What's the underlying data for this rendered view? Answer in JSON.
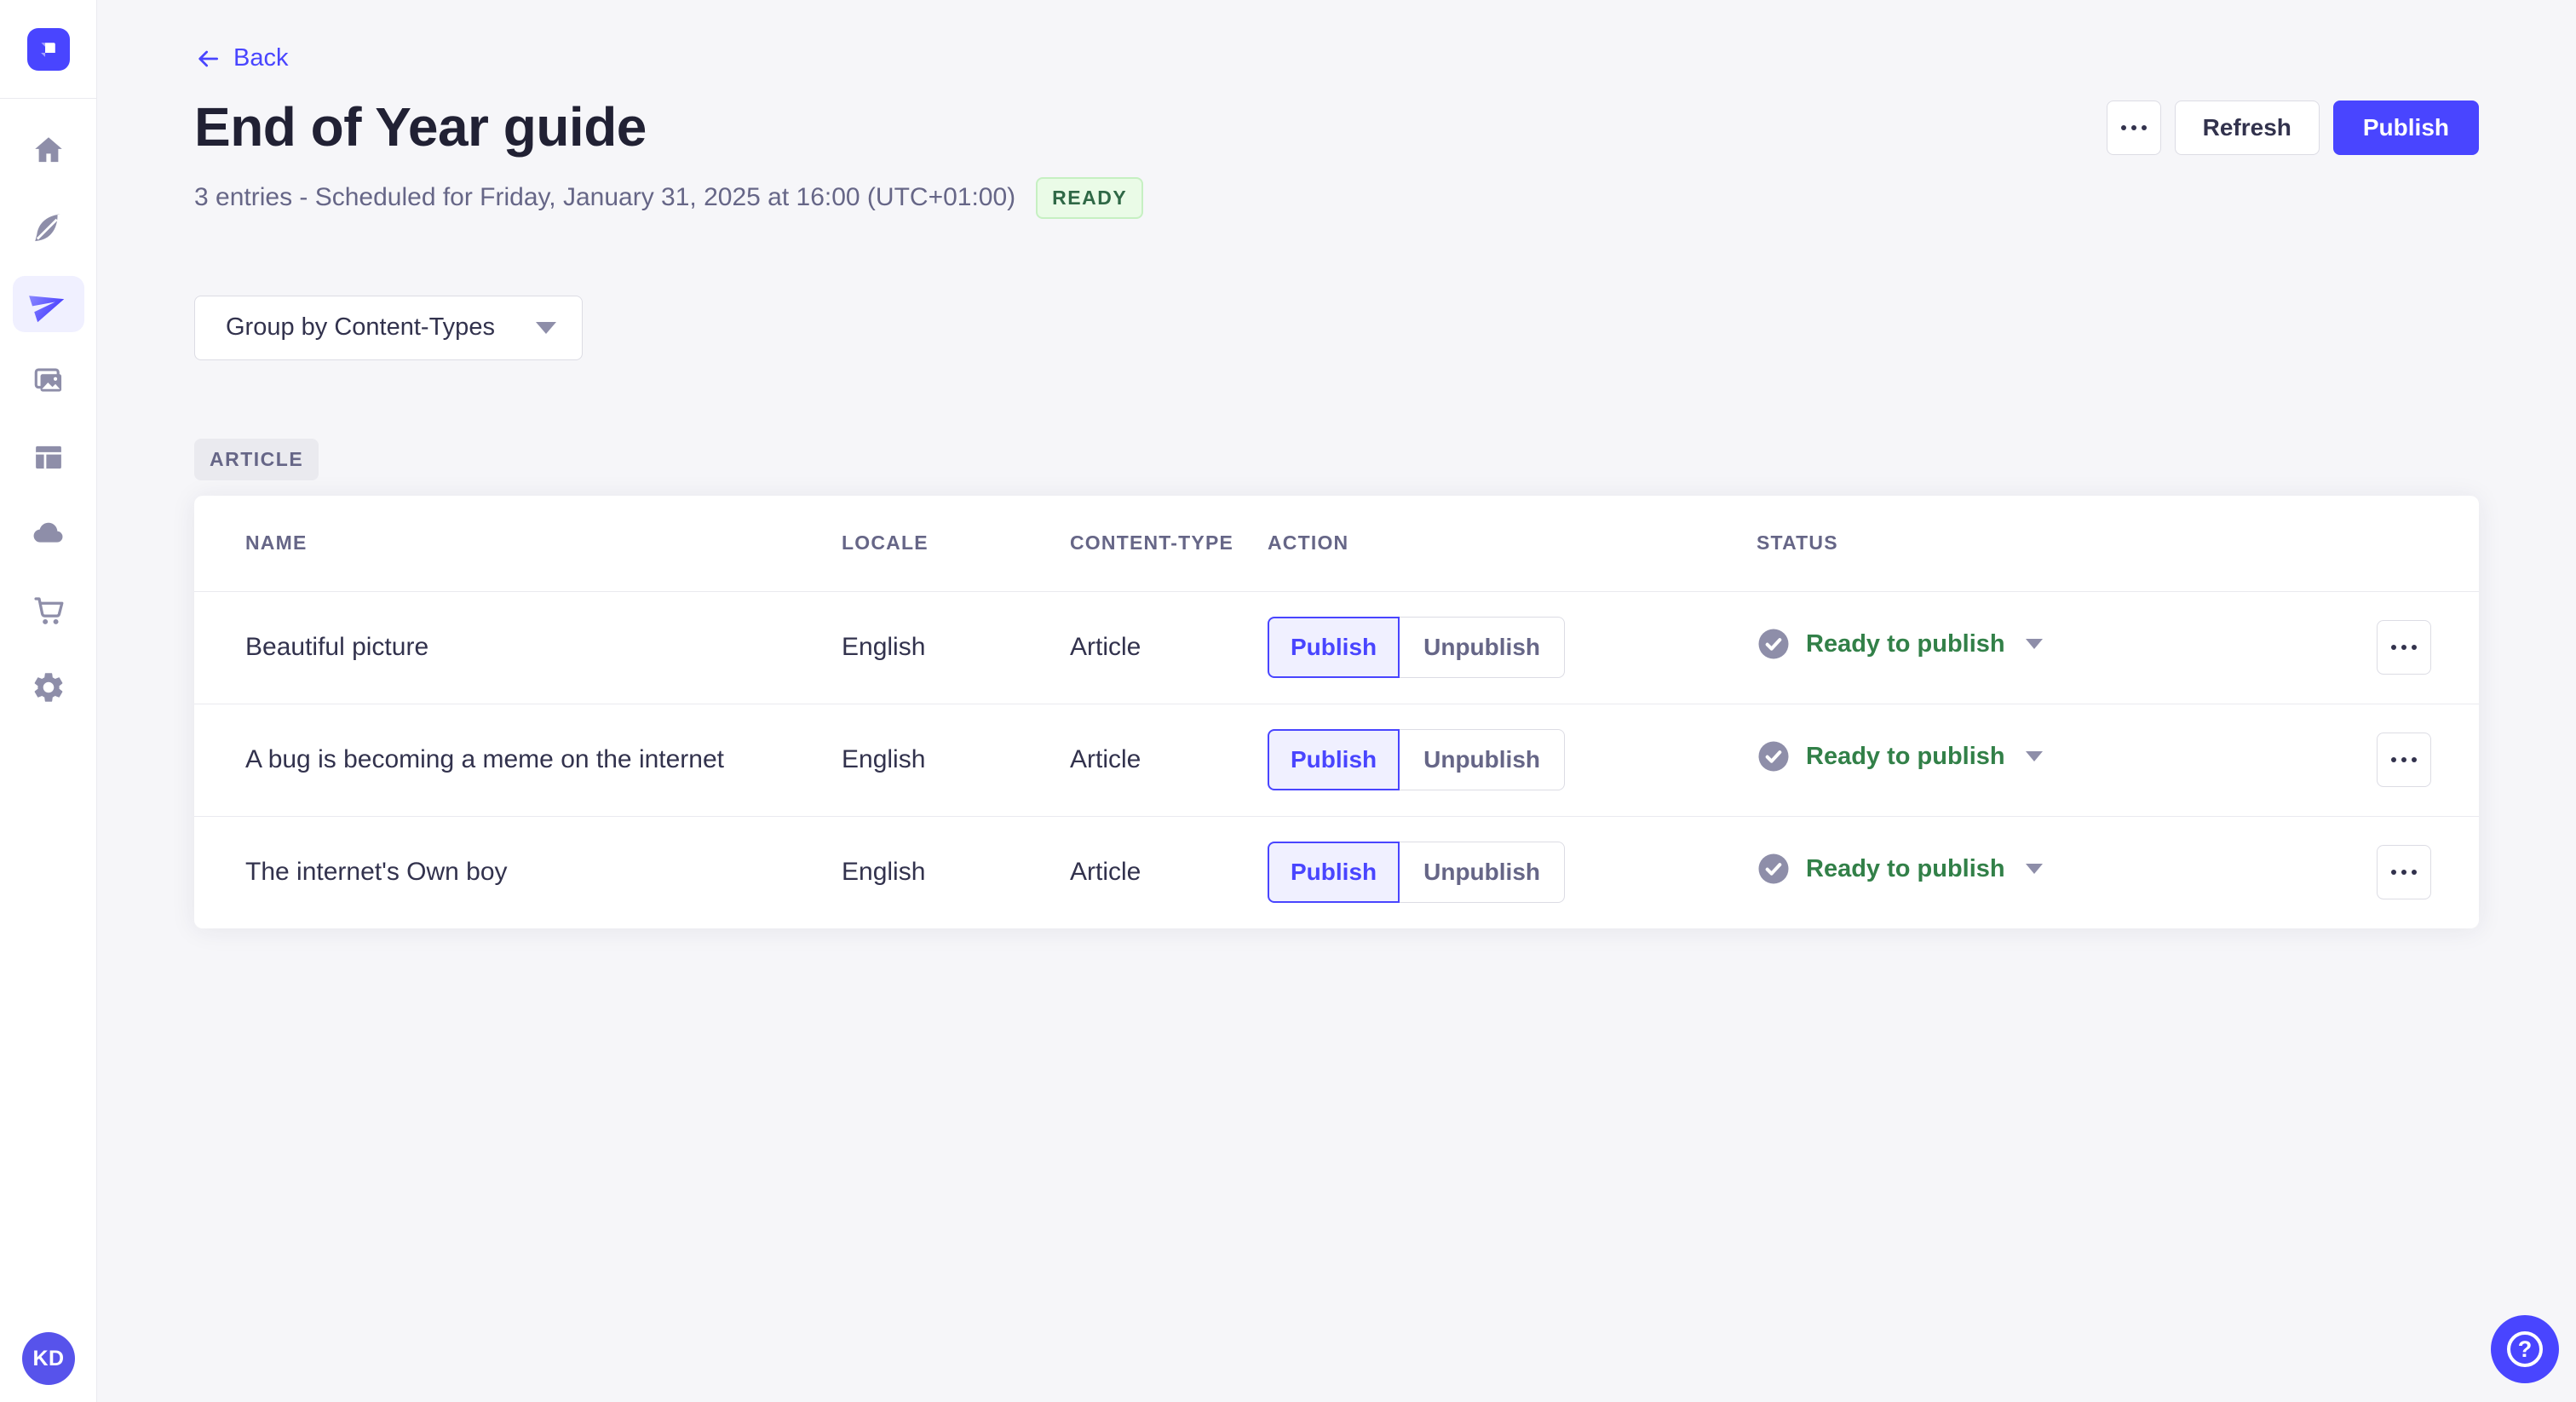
{
  "colors": {
    "accent": "#4945ff",
    "accent_light_bg": "#f0f0ff",
    "page_bg": "#f6f6f9",
    "card_bg": "#ffffff",
    "border": "#dcdce4",
    "divider": "#eaeaef",
    "title_text": "#212134",
    "body_text": "#32324d",
    "muted_text": "#666687",
    "icon_gray": "#8e8ea9",
    "ready_badge_text": "#2f6846",
    "ready_badge_bg": "#eafbe7",
    "ready_badge_border": "#c6f0c2",
    "status_green": "#328048",
    "avatar_bg": "#5753eb"
  },
  "sidebar": {
    "logo_icon": "strapi-logo-icon",
    "items": [
      {
        "icon": "home-icon",
        "active": false
      },
      {
        "icon": "feather-icon",
        "active": false
      },
      {
        "icon": "paper-plane-icon",
        "active": true
      },
      {
        "icon": "images-icon",
        "active": false
      },
      {
        "icon": "layout-icon",
        "active": false
      },
      {
        "icon": "cloud-icon",
        "active": false
      },
      {
        "icon": "cart-icon",
        "active": false
      },
      {
        "icon": "gear-icon",
        "active": false
      }
    ],
    "avatar_initials": "KD"
  },
  "header": {
    "back_label": "Back",
    "title": "End of Year guide",
    "subtitle": "3 entries - Scheduled for Friday, January 31, 2025 at 16:00 (UTC+01:00)",
    "status_badge": "READY",
    "more_icon": "ellipsis-icon",
    "refresh_label": "Refresh",
    "publish_label": "Publish"
  },
  "toolbar": {
    "group_by_label": "Group by Content-Types",
    "caret_icon": "chevron-down-icon"
  },
  "group": {
    "label": "ARTICLE"
  },
  "table": {
    "columns": [
      "NAME",
      "LOCALE",
      "CONTENT-TYPE",
      "ACTION",
      "STATUS"
    ],
    "action_labels": {
      "publish": "Publish",
      "unpublish": "Unpublish"
    },
    "status_icon": "check-circle-icon",
    "row_more_icon": "ellipsis-icon",
    "rows": [
      {
        "name": "Beautiful picture",
        "locale": "English",
        "content_type": "Article",
        "selected_action": "publish",
        "status": "Ready to publish"
      },
      {
        "name": "A bug is becoming a meme on the internet",
        "locale": "English",
        "content_type": "Article",
        "selected_action": "publish",
        "status": "Ready to publish"
      },
      {
        "name": "The internet's Own boy",
        "locale": "English",
        "content_type": "Article",
        "selected_action": "publish",
        "status": "Ready to publish"
      }
    ]
  },
  "fab": {
    "icon": "question-mark-icon"
  }
}
